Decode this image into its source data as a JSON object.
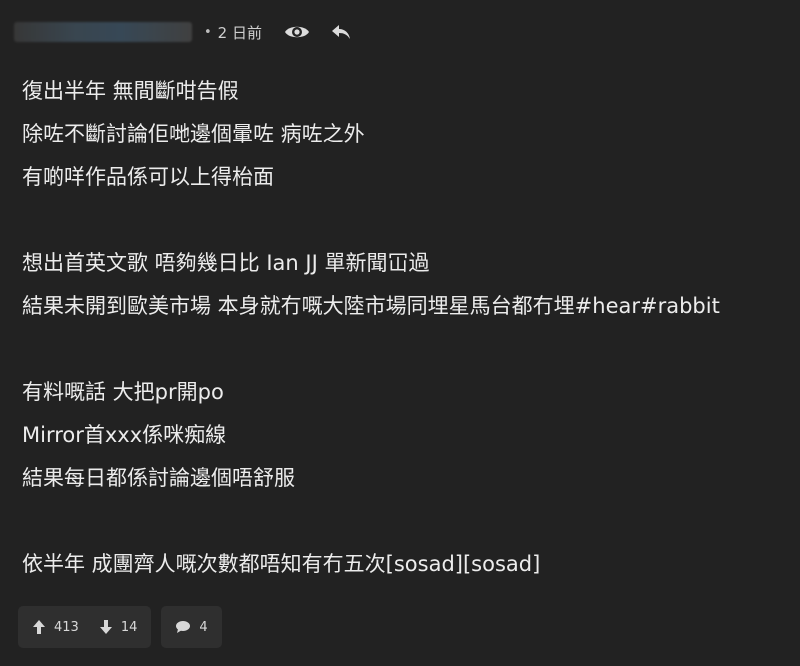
{
  "post": {
    "timestamp": "2 日前",
    "separator": "•",
    "icons": {
      "view": "eye-icon",
      "reply": "reply-icon"
    },
    "lines": [
      "復出半年 無間斷咁告假",
      "除咗不斷討論佢哋邊個暈咗 病咗之外",
      "有啲咩作品係可以上得枱面",
      "",
      "想出首英文歌 唔夠幾日比 Ian JJ 單新聞冚過",
      "結果未開到歐美市場 本身就冇嘅大陸市場同埋星馬台都冇埋#hear#rabbit",
      "",
      "有料嘅話 大把pr開po",
      "Mirror首xxx係咪痴線",
      "結果每日都係討論邊個唔舒服",
      "",
      "依半年 成團齊人嘅次數都唔知有冇五次[sosad][sosad]"
    ]
  },
  "footer": {
    "upvotes": "413",
    "downvotes": "14",
    "comments": "4",
    "icons": {
      "up": "arrow-up-icon",
      "down": "arrow-down-icon",
      "comment": "comment-icon"
    }
  }
}
